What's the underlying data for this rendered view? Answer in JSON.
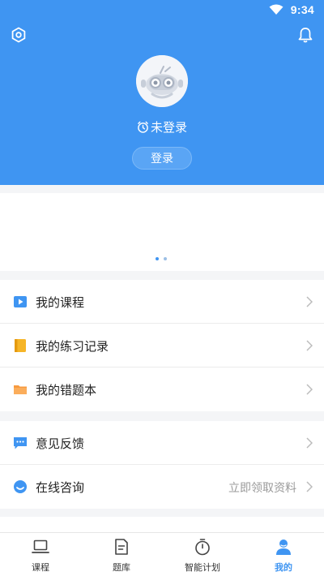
{
  "status_bar": {
    "time": "9:34"
  },
  "profile": {
    "login_status": "未登录",
    "login_button": "登录"
  },
  "colors": {
    "primary": "#3f95f2",
    "background": "#f4f5f7"
  },
  "menu_group_1": [
    {
      "label": "我的课程",
      "icon": "play-icon"
    },
    {
      "label": "我的练习记录",
      "icon": "notebook-icon"
    },
    {
      "label": "我的错题本",
      "icon": "folder-icon"
    }
  ],
  "menu_group_2": [
    {
      "label": "意见反馈",
      "icon": "chat-icon"
    },
    {
      "label": "在线咨询",
      "icon": "headset-icon",
      "extra": "立即领取资料"
    }
  ],
  "tabs": [
    {
      "label": "课程",
      "icon": "laptop-icon",
      "active": false
    },
    {
      "label": "题库",
      "icon": "document-icon",
      "active": false
    },
    {
      "label": "智能计划",
      "icon": "stopwatch-icon",
      "active": false
    },
    {
      "label": "我的",
      "icon": "user-icon",
      "active": true
    }
  ]
}
